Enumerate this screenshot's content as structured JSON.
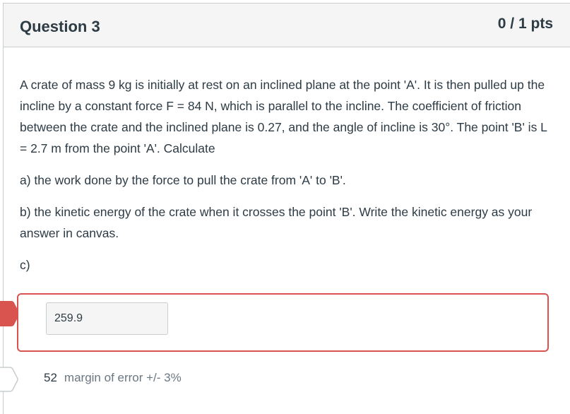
{
  "question": {
    "title": "Question 3",
    "points": "0 / 1 pts",
    "paragraphs": [
      "A crate of mass 9 kg is initially at rest on an inclined plane at the point 'A'. It is then pulled up the incline by a constant force F = 84 N,  which is parallel to the incline. The coefficient of friction between the crate and the inclined plane is 0.27, and the angle of incline is 30°. The point 'B' is L = 2.7 m from the point 'A'. Calculate",
      "a) the work done by the force to pull the crate from 'A' to 'B'.",
      "b) the kinetic energy of the crate when it crosses the point 'B'. Write the kinetic energy as your answer in canvas.",
      "c)"
    ]
  },
  "answer": {
    "user_value": "259.9",
    "status": "incorrect",
    "status_color": "#d9534f"
  },
  "correct": {
    "value": "52",
    "margin_text": "margin of error +/- 3%"
  }
}
